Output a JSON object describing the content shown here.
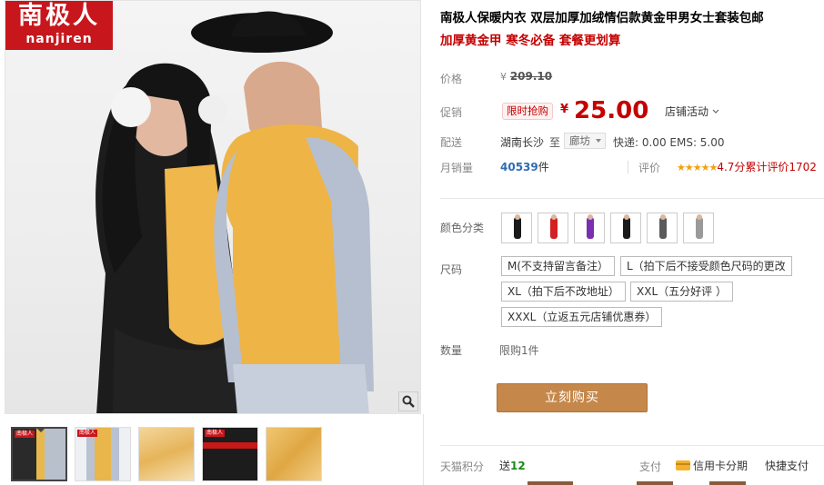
{
  "product": {
    "title": "南极人保暖内衣 双层加厚加绒情侣款黄金甲男女士套装包邮",
    "subtitle": "加厚黄金甲 寒冬必备 套餐更划算"
  },
  "brand": {
    "name_cn": "南极人",
    "name_en": "nanjiren"
  },
  "price": {
    "label": "价格",
    "currency": "¥",
    "original": "209.10"
  },
  "promo": {
    "label": "促销",
    "tag": "限时抢购",
    "currency": "¥",
    "price": "25.00",
    "shop_activity": "店铺活动"
  },
  "delivery": {
    "label": "配送",
    "from": "湖南长沙",
    "to_word": "至",
    "destination": "廊坊",
    "shipping": "快递: 0.00 EMS: 5.00"
  },
  "sales": {
    "label": "月销量",
    "count": "40539",
    "unit": "件",
    "review_label": "评价",
    "stars": "★★★★★",
    "rating_text": "4.7分",
    "review_count": "累计评价1702"
  },
  "color": {
    "label": "颜色分类",
    "swatches": [
      "#1a1a1a",
      "#d42020",
      "#7a2fb0",
      "#1a1a1a",
      "#5a5a5a",
      "#9a9a9a"
    ]
  },
  "size": {
    "label": "尺码",
    "options": [
      "M(不支持留言备注）",
      "L（拍下后不接受颜色尺码的更改",
      "XL（拍下后不改地址）",
      "XXL（五分好评 ）",
      "XXXL（立返五元店铺优惠券）"
    ]
  },
  "quantity": {
    "label": "数量",
    "limit": "限购1件"
  },
  "buy_button": "立刻购买",
  "points": {
    "label": "天猫积分",
    "send": "送",
    "value": "12"
  },
  "payment": {
    "label": "支付",
    "credit": "信用卡分期",
    "quick": "快捷支付"
  },
  "gallery": {
    "thumb_logo": "南极人"
  },
  "colors": {
    "accent_red": "#c40000",
    "buy_button": "#c5874a",
    "sales_blue": "#2f6bb5"
  }
}
